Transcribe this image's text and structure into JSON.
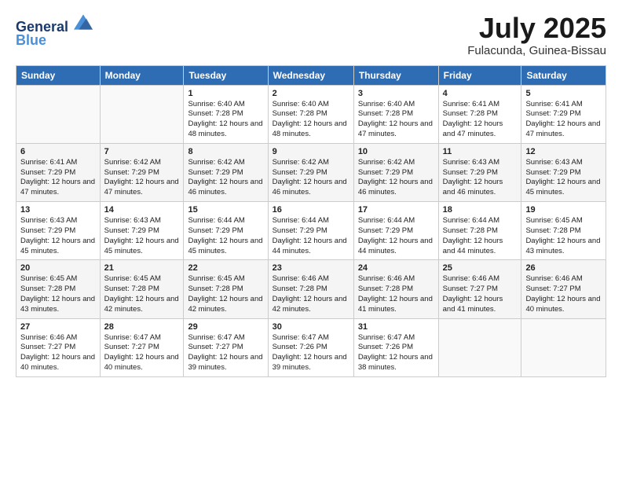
{
  "header": {
    "logo_line1": "General",
    "logo_line2": "Blue",
    "month": "July 2025",
    "location": "Fulacunda, Guinea-Bissau"
  },
  "weekdays": [
    "Sunday",
    "Monday",
    "Tuesday",
    "Wednesday",
    "Thursday",
    "Friday",
    "Saturday"
  ],
  "weeks": [
    [
      {
        "day": "",
        "sunrise": "",
        "sunset": "",
        "daylight": ""
      },
      {
        "day": "",
        "sunrise": "",
        "sunset": "",
        "daylight": ""
      },
      {
        "day": "1",
        "sunrise": "Sunrise: 6:40 AM",
        "sunset": "Sunset: 7:28 PM",
        "daylight": "Daylight: 12 hours and 48 minutes."
      },
      {
        "day": "2",
        "sunrise": "Sunrise: 6:40 AM",
        "sunset": "Sunset: 7:28 PM",
        "daylight": "Daylight: 12 hours and 48 minutes."
      },
      {
        "day": "3",
        "sunrise": "Sunrise: 6:40 AM",
        "sunset": "Sunset: 7:28 PM",
        "daylight": "Daylight: 12 hours and 47 minutes."
      },
      {
        "day": "4",
        "sunrise": "Sunrise: 6:41 AM",
        "sunset": "Sunset: 7:28 PM",
        "daylight": "Daylight: 12 hours and 47 minutes."
      },
      {
        "day": "5",
        "sunrise": "Sunrise: 6:41 AM",
        "sunset": "Sunset: 7:29 PM",
        "daylight": "Daylight: 12 hours and 47 minutes."
      }
    ],
    [
      {
        "day": "6",
        "sunrise": "Sunrise: 6:41 AM",
        "sunset": "Sunset: 7:29 PM",
        "daylight": "Daylight: 12 hours and 47 minutes."
      },
      {
        "day": "7",
        "sunrise": "Sunrise: 6:42 AM",
        "sunset": "Sunset: 7:29 PM",
        "daylight": "Daylight: 12 hours and 47 minutes."
      },
      {
        "day": "8",
        "sunrise": "Sunrise: 6:42 AM",
        "sunset": "Sunset: 7:29 PM",
        "daylight": "Daylight: 12 hours and 46 minutes."
      },
      {
        "day": "9",
        "sunrise": "Sunrise: 6:42 AM",
        "sunset": "Sunset: 7:29 PM",
        "daylight": "Daylight: 12 hours and 46 minutes."
      },
      {
        "day": "10",
        "sunrise": "Sunrise: 6:42 AM",
        "sunset": "Sunset: 7:29 PM",
        "daylight": "Daylight: 12 hours and 46 minutes."
      },
      {
        "day": "11",
        "sunrise": "Sunrise: 6:43 AM",
        "sunset": "Sunset: 7:29 PM",
        "daylight": "Daylight: 12 hours and 46 minutes."
      },
      {
        "day": "12",
        "sunrise": "Sunrise: 6:43 AM",
        "sunset": "Sunset: 7:29 PM",
        "daylight": "Daylight: 12 hours and 45 minutes."
      }
    ],
    [
      {
        "day": "13",
        "sunrise": "Sunrise: 6:43 AM",
        "sunset": "Sunset: 7:29 PM",
        "daylight": "Daylight: 12 hours and 45 minutes."
      },
      {
        "day": "14",
        "sunrise": "Sunrise: 6:43 AM",
        "sunset": "Sunset: 7:29 PM",
        "daylight": "Daylight: 12 hours and 45 minutes."
      },
      {
        "day": "15",
        "sunrise": "Sunrise: 6:44 AM",
        "sunset": "Sunset: 7:29 PM",
        "daylight": "Daylight: 12 hours and 45 minutes."
      },
      {
        "day": "16",
        "sunrise": "Sunrise: 6:44 AM",
        "sunset": "Sunset: 7:29 PM",
        "daylight": "Daylight: 12 hours and 44 minutes."
      },
      {
        "day": "17",
        "sunrise": "Sunrise: 6:44 AM",
        "sunset": "Sunset: 7:29 PM",
        "daylight": "Daylight: 12 hours and 44 minutes."
      },
      {
        "day": "18",
        "sunrise": "Sunrise: 6:44 AM",
        "sunset": "Sunset: 7:28 PM",
        "daylight": "Daylight: 12 hours and 44 minutes."
      },
      {
        "day": "19",
        "sunrise": "Sunrise: 6:45 AM",
        "sunset": "Sunset: 7:28 PM",
        "daylight": "Daylight: 12 hours and 43 minutes."
      }
    ],
    [
      {
        "day": "20",
        "sunrise": "Sunrise: 6:45 AM",
        "sunset": "Sunset: 7:28 PM",
        "daylight": "Daylight: 12 hours and 43 minutes."
      },
      {
        "day": "21",
        "sunrise": "Sunrise: 6:45 AM",
        "sunset": "Sunset: 7:28 PM",
        "daylight": "Daylight: 12 hours and 42 minutes."
      },
      {
        "day": "22",
        "sunrise": "Sunrise: 6:45 AM",
        "sunset": "Sunset: 7:28 PM",
        "daylight": "Daylight: 12 hours and 42 minutes."
      },
      {
        "day": "23",
        "sunrise": "Sunrise: 6:46 AM",
        "sunset": "Sunset: 7:28 PM",
        "daylight": "Daylight: 12 hours and 42 minutes."
      },
      {
        "day": "24",
        "sunrise": "Sunrise: 6:46 AM",
        "sunset": "Sunset: 7:28 PM",
        "daylight": "Daylight: 12 hours and 41 minutes."
      },
      {
        "day": "25",
        "sunrise": "Sunrise: 6:46 AM",
        "sunset": "Sunset: 7:27 PM",
        "daylight": "Daylight: 12 hours and 41 minutes."
      },
      {
        "day": "26",
        "sunrise": "Sunrise: 6:46 AM",
        "sunset": "Sunset: 7:27 PM",
        "daylight": "Daylight: 12 hours and 40 minutes."
      }
    ],
    [
      {
        "day": "27",
        "sunrise": "Sunrise: 6:46 AM",
        "sunset": "Sunset: 7:27 PM",
        "daylight": "Daylight: 12 hours and 40 minutes."
      },
      {
        "day": "28",
        "sunrise": "Sunrise: 6:47 AM",
        "sunset": "Sunset: 7:27 PM",
        "daylight": "Daylight: 12 hours and 40 minutes."
      },
      {
        "day": "29",
        "sunrise": "Sunrise: 6:47 AM",
        "sunset": "Sunset: 7:27 PM",
        "daylight": "Daylight: 12 hours and 39 minutes."
      },
      {
        "day": "30",
        "sunrise": "Sunrise: 6:47 AM",
        "sunset": "Sunset: 7:26 PM",
        "daylight": "Daylight: 12 hours and 39 minutes."
      },
      {
        "day": "31",
        "sunrise": "Sunrise: 6:47 AM",
        "sunset": "Sunset: 7:26 PM",
        "daylight": "Daylight: 12 hours and 38 minutes."
      },
      {
        "day": "",
        "sunrise": "",
        "sunset": "",
        "daylight": ""
      },
      {
        "day": "",
        "sunrise": "",
        "sunset": "",
        "daylight": ""
      }
    ]
  ]
}
